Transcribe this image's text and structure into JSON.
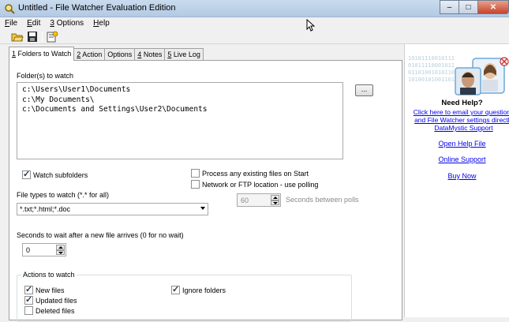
{
  "window": {
    "title": "Untitled - File Watcher Evaluation Edition",
    "min_label": "–",
    "max_label": "□",
    "close_label": "✕"
  },
  "menu": [
    {
      "key": "F",
      "rest": "ile"
    },
    {
      "key": "E",
      "rest": "dit"
    },
    {
      "key": "3",
      "rest": " Options"
    },
    {
      "key": "H",
      "rest": "elp"
    }
  ],
  "toolbar": {
    "buttons": [
      "open-icon",
      "save-icon",
      "wizard-icon"
    ]
  },
  "tabs": [
    {
      "label": "1 Folders to Watch",
      "key": "1",
      "rest": " Folders to Watch",
      "active": true
    },
    {
      "label": "2 Action",
      "key": "2",
      "rest": " Action",
      "active": false
    },
    {
      "label": "Options",
      "key": "",
      "rest": "Options",
      "active": false
    },
    {
      "label": "4 Notes",
      "key": "4",
      "rest": " Notes",
      "active": false
    },
    {
      "label": "5 Live Log",
      "key": "5",
      "rest": " Live Log",
      "active": false
    }
  ],
  "folders": {
    "label": "Folder(s) to watch",
    "paths": [
      "c:\\Users\\User1\\Documents",
      "c:\\My Documents\\",
      "c:\\Documents and Settings\\User2\\Documents"
    ],
    "browse_label": "..."
  },
  "options": {
    "watch_subfolders": {
      "label": "Watch subfolders",
      "checked": true
    },
    "process_existing": {
      "label": "Process any existing files on Start",
      "checked": false
    },
    "network_polling": {
      "label": "Network or FTP location - use polling",
      "checked": false
    }
  },
  "file_types": {
    "label": "File types to watch (*.* for all)",
    "value": "*.txt;*.html;*.doc"
  },
  "polling": {
    "value": "60",
    "label": "Seconds between polls"
  },
  "wait": {
    "label": "Seconds to wait after a new file arrives (0 for no wait)",
    "value": "0"
  },
  "actions": {
    "title": "Actions to watch",
    "new_files": {
      "label": "New files",
      "checked": true
    },
    "updated_files": {
      "label": "Updated files",
      "checked": true
    },
    "deleted_files": {
      "label": "Deleted files",
      "checked": false
    },
    "ignore_folders": {
      "label": "Ignore folders",
      "checked": true
    }
  },
  "help_panel": {
    "binary": "10101110010111\n01011110001011\n01101001010110\n10100101001101",
    "need_help": "Need Help?",
    "desc_line1": "Click here to email your questions",
    "desc_line2": "and File Watcher settings directly",
    "desc_line3": "DataMystic Support",
    "links": [
      "Open Help File",
      "Online Support",
      "Buy Now"
    ]
  },
  "colors": {
    "link": "#0000ee",
    "titlebar": "#c9dbee",
    "close": "#c7432a"
  }
}
